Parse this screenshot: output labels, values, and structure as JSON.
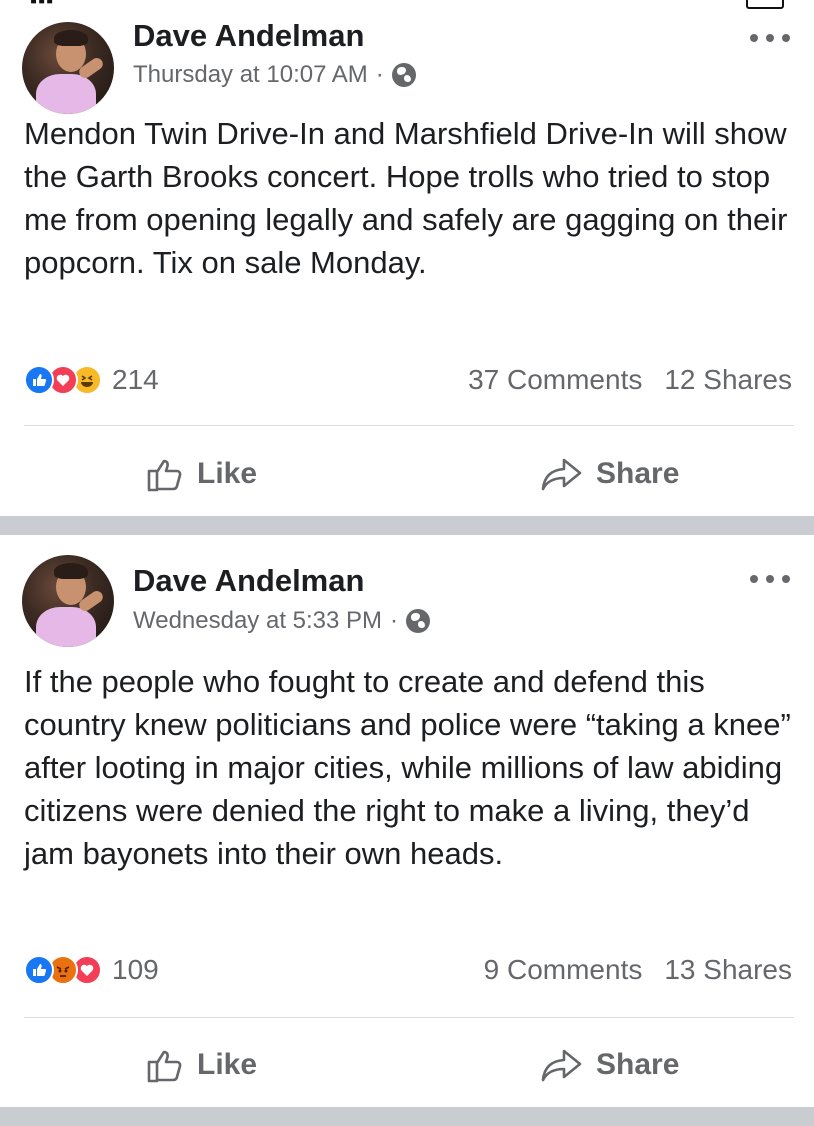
{
  "posts": [
    {
      "author": "Dave Andelman",
      "timestamp": "Thursday at 10:07 AM",
      "separator": "·",
      "privacy_icon": "globe-icon",
      "text": "Mendon Twin Drive-In and Marshfield Drive-In will show the Garth Brooks concert.  Hope trolls who tried to stop me from opening legally and safely are gagging on their popcorn.  Tix on sale Monday.",
      "reactions": [
        "like",
        "love",
        "haha"
      ],
      "reaction_count": "214",
      "comments": "37 Comments",
      "shares": "12 Shares",
      "like_label": "Like",
      "share_label": "Share"
    },
    {
      "author": "Dave Andelman",
      "timestamp": "Wednesday at 5:33 PM",
      "separator": "·",
      "privacy_icon": "globe-icon",
      "text": "If the people who fought to create and defend this country knew politicians and police were “taking a knee” after looting in major cities, while millions of law abiding citizens were denied the right to make a living, they’d jam bayonets into their own heads.",
      "reactions": [
        "like",
        "angry",
        "love"
      ],
      "reaction_count": "109",
      "comments": "9 Comments",
      "shares": "13 Shares",
      "like_label": "Like",
      "share_label": "Share"
    }
  ],
  "colors": {
    "like_blue": "#1877f2",
    "love_red": "#f33e58",
    "haha_yellow": "#f7b928",
    "angry_orange": "#e9710f",
    "secondary_text": "#65676b",
    "divider_band": "#c9ccd1"
  }
}
